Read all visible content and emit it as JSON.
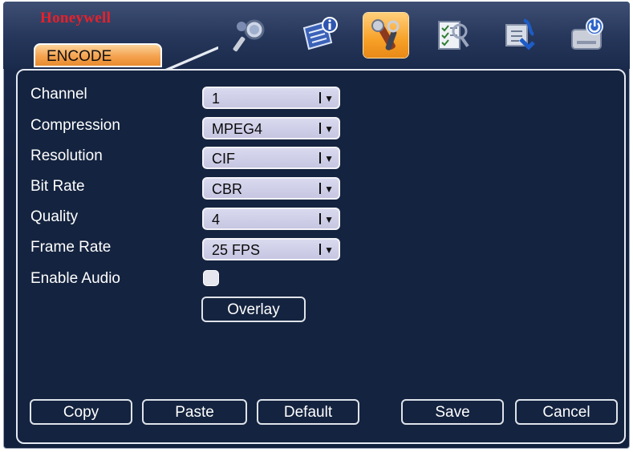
{
  "header": {
    "brand": "Honeywell",
    "active_tab": "ENCODE",
    "icons": [
      "search-icon",
      "info-icon",
      "tools-icon",
      "checklist-icon",
      "network-icon",
      "shutdown-icon"
    ],
    "active_icon": "tools-icon",
    "accent_color": "#f7a128"
  },
  "form": {
    "channel": {
      "label": "Channel",
      "value": "1"
    },
    "compression": {
      "label": "Compression",
      "value": "MPEG4"
    },
    "resolution": {
      "label": "Resolution",
      "value": "CIF"
    },
    "bit_rate": {
      "label": "Bit Rate",
      "value": "CBR"
    },
    "quality": {
      "label": "Quality",
      "value": "4"
    },
    "frame_rate": {
      "label": "Frame Rate",
      "value": "25 FPS"
    },
    "enable_audio": {
      "label": "Enable Audio",
      "checked": false
    },
    "overlay_label": "Overlay"
  },
  "buttons": {
    "copy": "Copy",
    "paste": "Paste",
    "default": "Default",
    "save": "Save",
    "cancel": "Cancel"
  }
}
